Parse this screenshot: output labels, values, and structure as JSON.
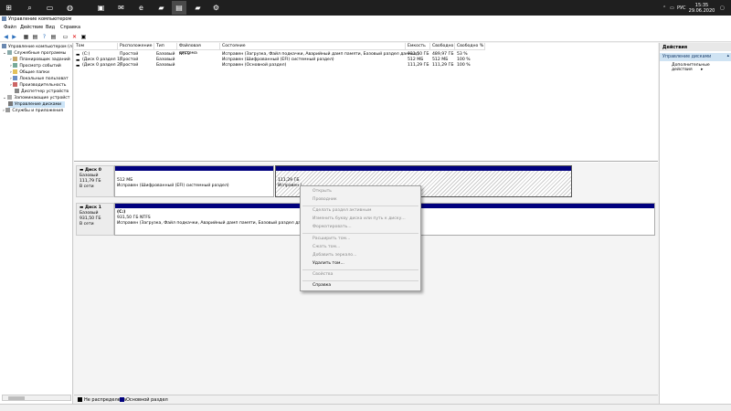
{
  "taskbar": {
    "icons": [
      "search-icon",
      "task-view-icon",
      "store-icon",
      "mail-icon",
      "edge-icon",
      "folder-icon",
      "computer-management-icon",
      "terminal-icon",
      "settings-icon"
    ],
    "lang": "РУС",
    "time": "15:35",
    "date": "29.06.2020"
  },
  "window": {
    "title": "Управление компьютером"
  },
  "menu": {
    "file": "Файл",
    "action": "Действие",
    "view": "Вид",
    "help": "Справка"
  },
  "tree": {
    "root": "Управление компьютером (л",
    "utilities": "Служебные программы",
    "scheduler": "Планировщик заданий",
    "eventviewer": "Просмотр событий",
    "shared": "Общие папки",
    "users": "Локальные пользоват",
    "performance": "Производительность",
    "devices": "Диспетчер устройств",
    "storage": "Запоминающие устройст",
    "diskmgmt": "Управление дисками",
    "services": "Службы и приложения"
  },
  "table": {
    "headers": {
      "vol": "Том",
      "layout": "Расположение",
      "type": "Тип",
      "fs": "Файловая система",
      "status": "Состояние",
      "capacity": "Емкость",
      "free": "Свободно",
      "pct": "Свободно %"
    },
    "rows": [
      {
        "vol": "(C:)",
        "layout": "Простой",
        "type": "Базовый",
        "fs": "NTFS",
        "status": "Исправен (Загрузка, Файл подкачки, Аварийный дамп памяти, Базовый раздел данных)",
        "capacity": "931,50 ГБ",
        "free": "489,97 ГБ",
        "pct": "53 %"
      },
      {
        "vol": "(Диск 0 раздел 1)",
        "layout": "Простой",
        "type": "Базовый",
        "fs": "",
        "status": "Исправен (Шифрованный (EFI) системный раздел)",
        "capacity": "512 МБ",
        "free": "512 МБ",
        "pct": "100 %"
      },
      {
        "vol": "(Диск 0 раздел 2)",
        "layout": "Простой",
        "type": "Базовый",
        "fs": "",
        "status": "Исправен (Основной раздел)",
        "capacity": "111,29 ГБ",
        "free": "111,29 ГБ",
        "pct": "100 %"
      }
    ]
  },
  "disks": {
    "d0": {
      "name": "Диск 0",
      "type": "Базовый",
      "size": "111,79 ГБ",
      "state": "В сети",
      "p1_size": "512 МБ",
      "p1_status": "Исправен (Шифрованный (EFI) системный раздел)",
      "p2_size": "111,29 ГБ",
      "p2_status": "Исправен ("
    },
    "d1": {
      "name": "Диск 1",
      "type": "Базовый",
      "size": "931,50 ГБ",
      "state": "В сети",
      "p_name": "(C:)",
      "p_size": "931,50 ГБ NTFS",
      "p_status": "Исправен (Загрузка, Файл подкачки, Аварийный дамп памяти, Базовый раздел данных)"
    }
  },
  "legend": {
    "unalloc": "Не распределена",
    "primary": "Основной раздел",
    "unalloc_color": "#000000",
    "primary_color": "#00007e"
  },
  "actions": {
    "title": "Действия",
    "section": "Управление дисками",
    "more": "Дополнительные действия"
  },
  "context_menu": {
    "open": "Открыть",
    "explore": "Проводник",
    "mark_active": "Сделать раздел активным",
    "change_letter": "Изменить букву диска или путь к диску...",
    "format": "Форматировать...",
    "extend": "Расширить том...",
    "shrink": "Сжать том...",
    "mirror": "Добавить зеркало...",
    "delete": "Удалить том...",
    "properties": "Свойства",
    "help": "Справка"
  }
}
